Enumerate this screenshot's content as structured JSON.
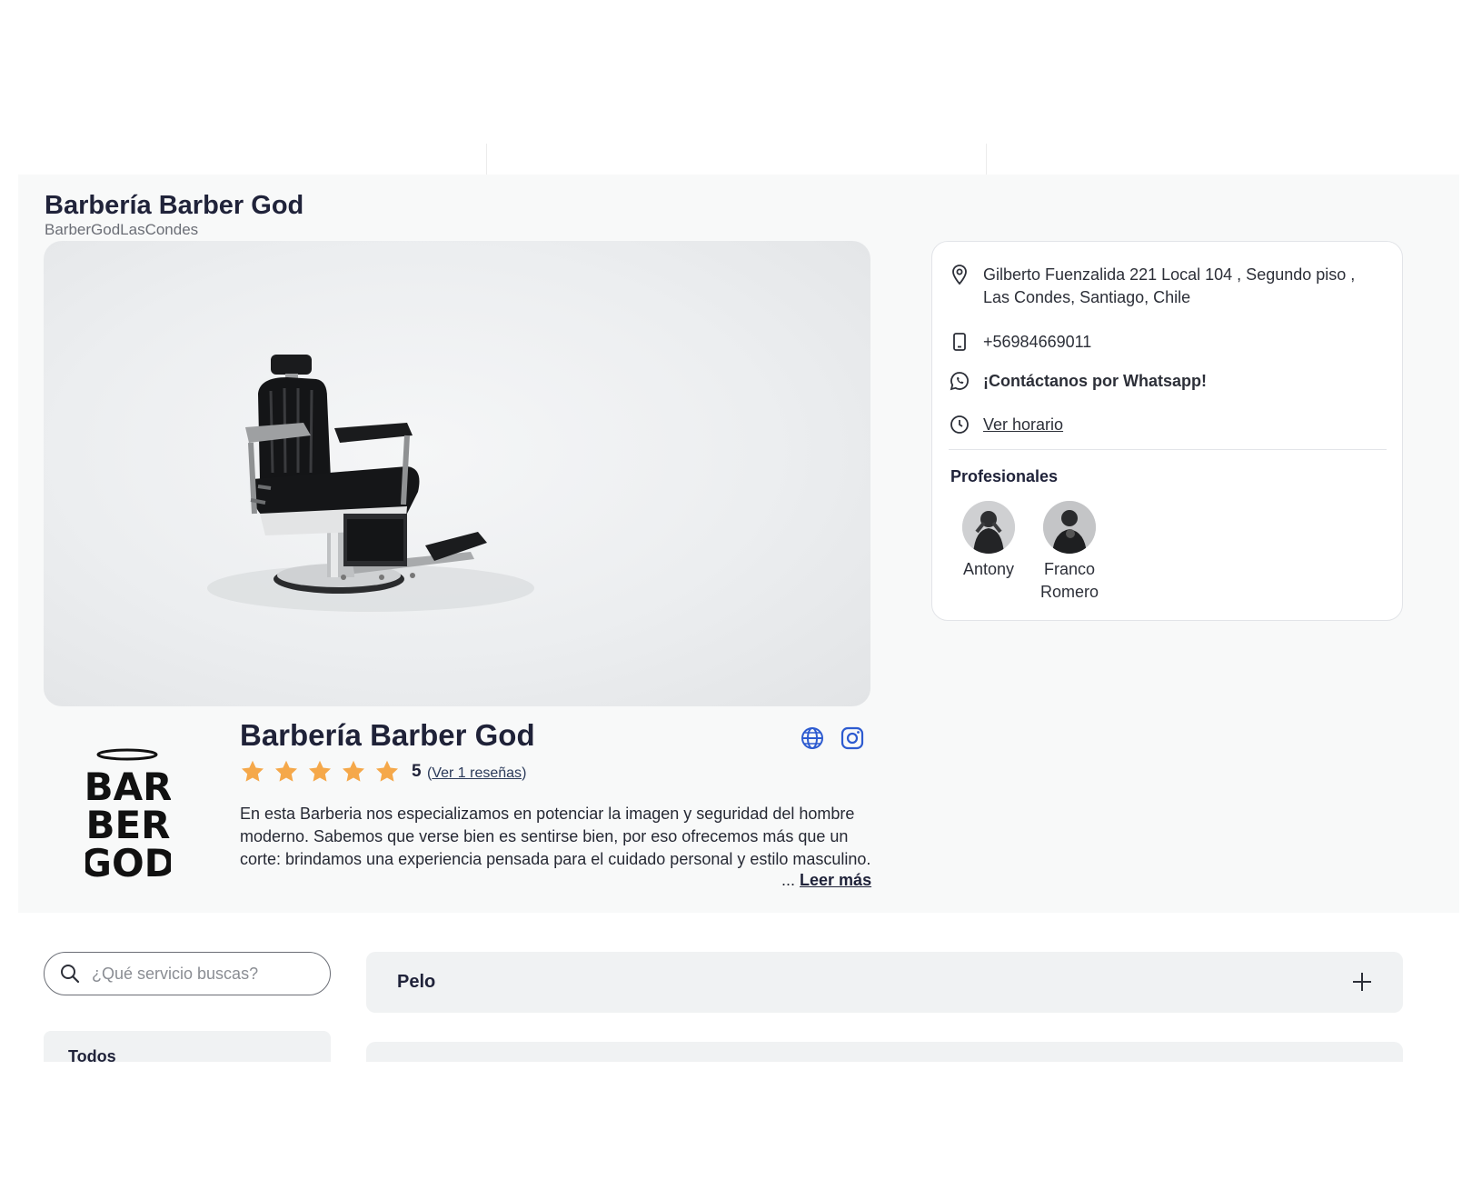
{
  "business": {
    "title": "Barbería Barber God",
    "handle": "BarberGodLasCondes",
    "name": "Barbería Barber God",
    "rating_value": "5",
    "rating_stars": 5,
    "reviews_link": "Ver 1 reseñas",
    "description": "En esta Barberia nos especializamos en potenciar la imagen y seguridad del hombre moderno. Sabemos que verse bien es sentirse bien, por eso ofrecemos más que un corte: brindamos una experiencia pensada para el cuidado personal y estilo masculino.",
    "more_prefix": "...",
    "more_link": "Leer más",
    "logo_text": [
      "BAR",
      "BER",
      "GOD"
    ],
    "links": {
      "website_icon": "globe-icon",
      "instagram_icon": "instagram-icon"
    }
  },
  "info": {
    "address": "Gilberto Fuenzalida 221 Local 104 , Segundo piso , Las Condes, Santiago, Chile",
    "phone": "+56984669011",
    "whatsapp": "¡Contáctanos por Whatsapp!",
    "schedule_link": "Ver horario",
    "professionals_title": "Profesionales",
    "professionals": [
      {
        "name": "Antony"
      },
      {
        "name": "Franco Romero"
      }
    ]
  },
  "search": {
    "placeholder": "¿Qué servicio buscas?",
    "value": ""
  },
  "categories": [
    {
      "label": "Todos"
    }
  ],
  "services": [
    {
      "label": "Pelo"
    }
  ],
  "colors": {
    "star": "#f5a84a",
    "accent_blue": "#2d5bd0",
    "panel_bg": "#f8f9f9",
    "accordion_bg": "#f0f2f3"
  }
}
